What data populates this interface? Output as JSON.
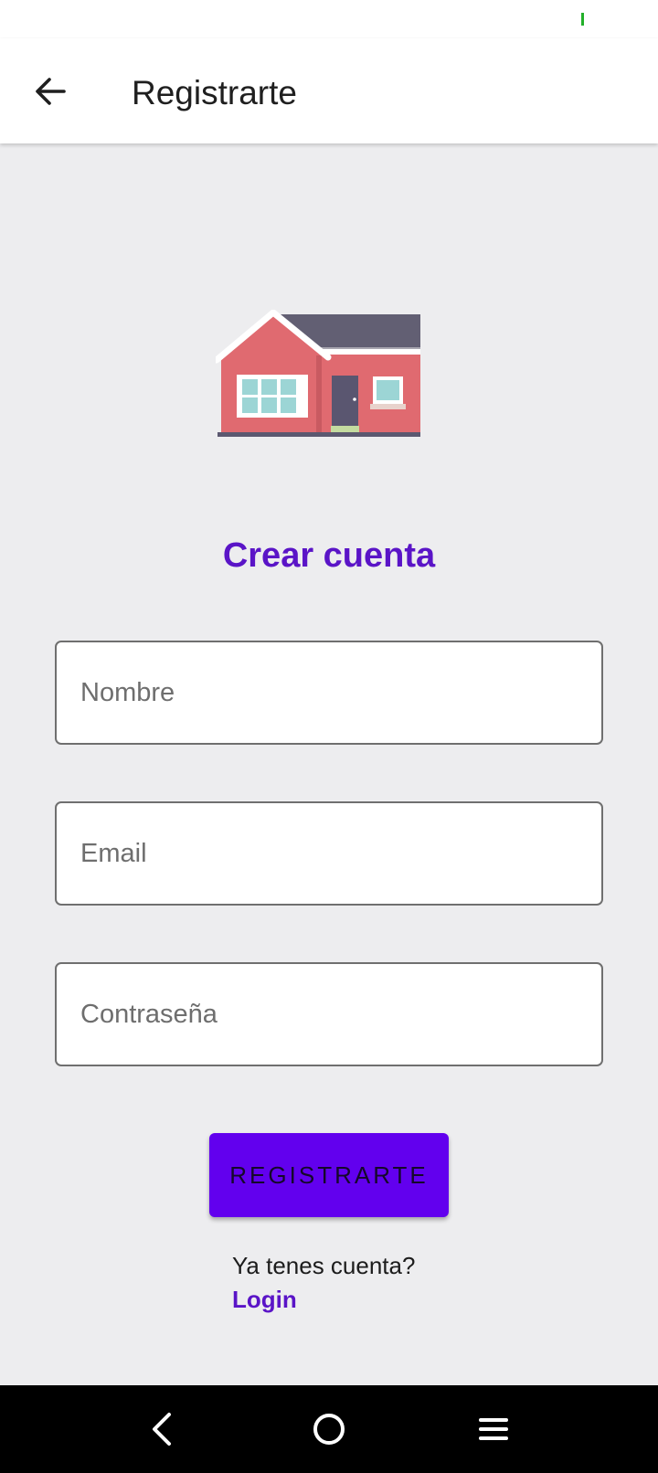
{
  "app_bar": {
    "title": "Registrarte"
  },
  "form": {
    "heading": "Crear cuenta",
    "name_placeholder": "Nombre",
    "email_placeholder": "Email",
    "password_placeholder": "Contraseña",
    "submit_label": "REGISTRARTE",
    "has_account_text": "Ya tenes cuenta?",
    "login_link": "Login"
  },
  "icons": {
    "back": "arrow-back-icon",
    "illustration": "house-illustration",
    "nav_back": "nav-back-icon",
    "nav_home": "nav-home-icon",
    "nav_menu": "nav-menu-icon"
  },
  "colors": {
    "accent": "#5a14c7",
    "button": "#6200ee",
    "status_indicator": "#22b02a"
  }
}
